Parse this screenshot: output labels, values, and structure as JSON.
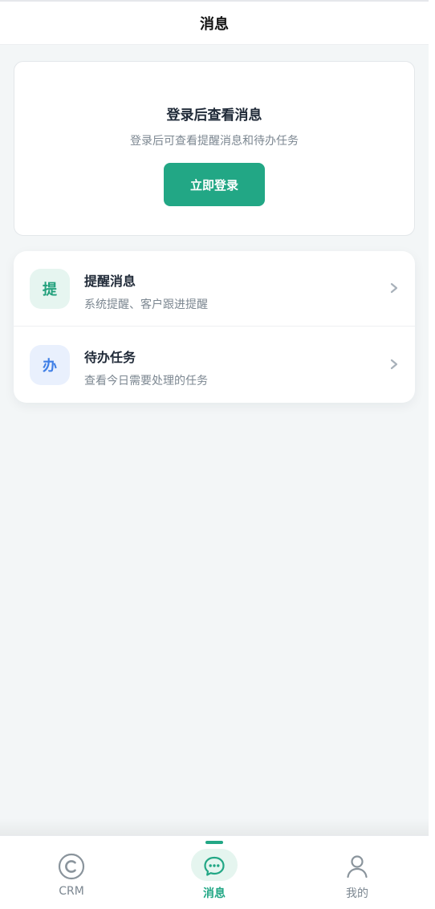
{
  "header": {
    "title": "消息"
  },
  "login": {
    "title": "登录后查看消息",
    "subtitle": "登录后可查看提醒消息和待办任务",
    "button_label": "立即登录"
  },
  "list": [
    {
      "badge": "提",
      "title": "提醒消息",
      "subtitle": "系统提醒、客户跟进提醒",
      "icon": "chevron-right-icon"
    },
    {
      "badge": "办",
      "title": "待办任务",
      "subtitle": "查看今日需要处理的任务",
      "icon": "chevron-right-icon"
    }
  ],
  "tabbar": {
    "tabs": [
      {
        "label": "CRM",
        "icon": "crm-c-icon",
        "active": false
      },
      {
        "label": "消息",
        "icon": "chat-bubble-icon",
        "active": true
      },
      {
        "label": "我的",
        "icon": "user-icon",
        "active": false
      }
    ]
  },
  "colors": {
    "accent": "#22a785",
    "accent_light": "#e5f5ef",
    "blue_badge_bg": "#e9f0fd",
    "blue_badge_text": "#3f7fe6",
    "muted_text": "#7c8791",
    "background": "#f3f6f7"
  }
}
